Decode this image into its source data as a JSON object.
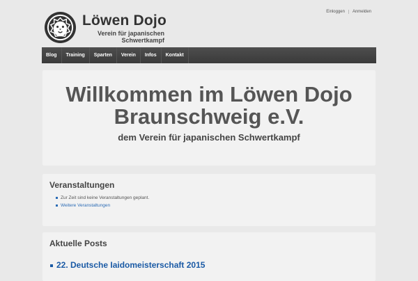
{
  "site": {
    "title": "Löwen Dojo",
    "subtitle": "Verein für japanischen Schwertkampf"
  },
  "toplinks": [
    "Einloggen",
    "Anmelden"
  ],
  "nav": [
    "Blog",
    "Training",
    "Sparten",
    "Verein",
    "Infos",
    "Kontakt"
  ],
  "hero": {
    "title": "Willkommen im Löwen Dojo Braunschweig e.V.",
    "subtitle": "dem Verein für japanischen Schwertkampf"
  },
  "events": {
    "title": "Veranstaltungen",
    "empty": "Zur Zeit sind keine Veranstaltungen geplant.",
    "more_link": "Weitere Veranstaltungen"
  },
  "posts": {
    "title": "Aktuelle Posts",
    "items": [
      "22. Deutsche Iaidomeisterschaft 2015"
    ]
  },
  "colors": {
    "nav_bg": "#444444",
    "link": "#2c6cb5",
    "panel_bg": "#f2f2f2",
    "page_bg": "#e9e9e9"
  }
}
